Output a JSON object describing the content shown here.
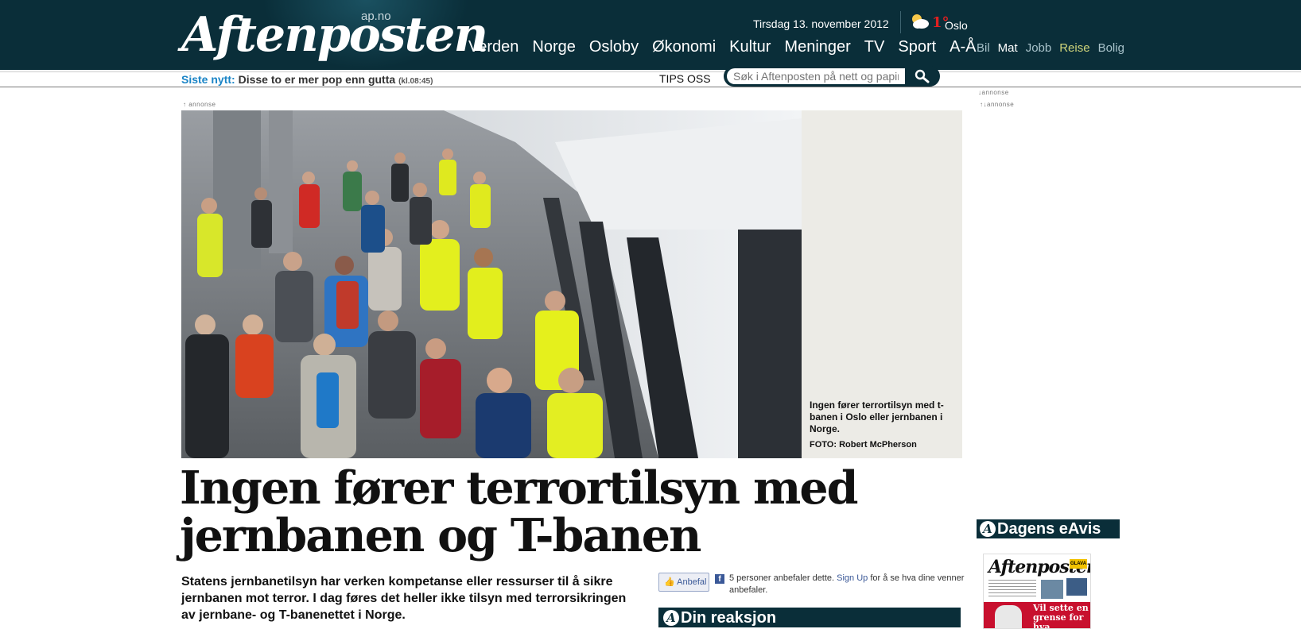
{
  "header": {
    "logo_text": "Aftenposten",
    "logo_sub": "ap.no",
    "date": "Tirsdag 13. november 2012",
    "weather": {
      "icon": "partly-cloudy-icon",
      "temp": "1°",
      "city": "Oslo"
    },
    "nav_main": [
      "Verden",
      "Norge",
      "Osloby",
      "Økonomi",
      "Kultur",
      "Meninger",
      "TV",
      "Sport",
      "A-Å"
    ],
    "nav_secondary": [
      "Bil",
      "Mat",
      "Jobb",
      "Reise",
      "Bolig"
    ]
  },
  "subbar": {
    "ticker_label": "Siste nytt:",
    "ticker_text": "Disse to er mer pop enn gutta",
    "ticker_time": "(kl.08:45)",
    "tips_label": "TIPS OSS",
    "search_placeholder": "Søk i Aftenposten på nett og papir"
  },
  "ads": {
    "label": "annonse"
  },
  "article": {
    "image_caption": "Ingen fører terrortilsyn med t-banen i Oslo eller jernbanen i Norge.",
    "photo_credit": "FOTO: Robert McPherson",
    "headline": "Ingen fører terrortilsyn med jernbanen og T-banen",
    "lede": "Statens jernbanetilsyn har verken kompetanse eller ressurser til å sikre jernbanen mot terror. I dag føres det heller ikke tilsyn med terrorsikringen av jernbane- og T-banenettet i Norge."
  },
  "social": {
    "recommend_label": "Anbefal",
    "text_before": "5 personer anbefaler dette.",
    "signup_link": "Sign Up",
    "text_after": "for å se hva dine venner anbefaler."
  },
  "reaction": {
    "title": "Din reaksjon"
  },
  "eavis": {
    "title": "Dagens eAvis",
    "thumb_logo": "Aftenposten",
    "thumb_badge": "GLAVA",
    "thumb_headline": "Vil sette en grense for hva"
  },
  "colors": {
    "header_bg": "#0a2e39",
    "ticker_label": "#1a84c6",
    "weather_temp": "#e02020"
  }
}
